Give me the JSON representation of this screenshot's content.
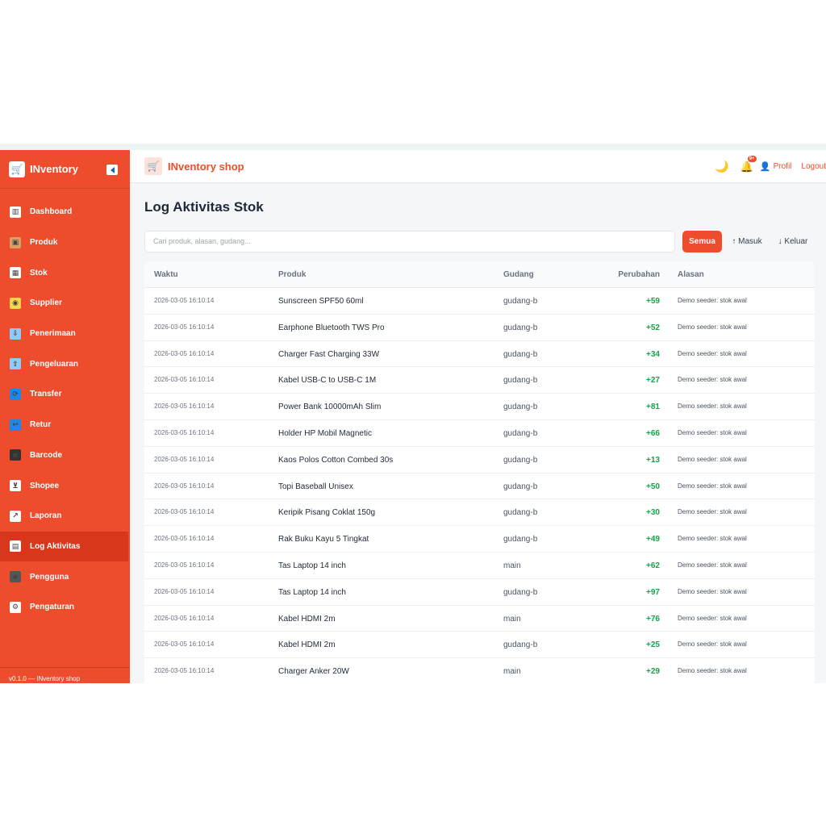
{
  "sidebar": {
    "brand": "INventory",
    "footer": "v0.1.0 — INventory shop",
    "items": [
      {
        "label": "Dashboard",
        "icon": "bar-chart-icon"
      },
      {
        "label": "Produk",
        "icon": "box-icon"
      },
      {
        "label": "Stok",
        "icon": "grid-icon"
      },
      {
        "label": "Supplier",
        "icon": "handshake-icon"
      },
      {
        "label": "Penerimaan",
        "icon": "inbox-tray-icon"
      },
      {
        "label": "Pengeluaran",
        "icon": "outbox-tray-icon"
      },
      {
        "label": "Transfer",
        "icon": "refresh-icon"
      },
      {
        "label": "Retur",
        "icon": "return-icon"
      },
      {
        "label": "Barcode",
        "icon": "camera-icon"
      },
      {
        "label": "Shopee",
        "icon": "cart-icon"
      },
      {
        "label": "Laporan",
        "icon": "chart-up-icon"
      },
      {
        "label": "Log Aktivitas",
        "icon": "clipboard-icon"
      },
      {
        "label": "Pengguna",
        "icon": "users-icon"
      },
      {
        "label": "Pengaturan",
        "icon": "gear-icon"
      }
    ]
  },
  "header": {
    "title": "INventory shop",
    "badge": "9+",
    "profil": "Profil",
    "logout": "Logout"
  },
  "page": {
    "title": "Log Aktivitas Stok",
    "search_placeholder": "Cari produk, alasan, gudang...",
    "filters": {
      "all": "Semua",
      "in": "↑ Masuk",
      "out": "↓ Keluar"
    }
  },
  "table": {
    "headers": {
      "time": "Waktu",
      "product": "Produk",
      "warehouse": "Gudang",
      "change": "Perubahan",
      "reason": "Alasan"
    },
    "rows": [
      {
        "time": "2026-03-05 16:10:14",
        "product": "Sunscreen SPF50 60ml",
        "warehouse": "gudang-b",
        "change": "+59",
        "reason": "Demo seeder: stok awal"
      },
      {
        "time": "2026-03-05 16:10:14",
        "product": "Earphone Bluetooth TWS Pro",
        "warehouse": "gudang-b",
        "change": "+52",
        "reason": "Demo seeder: stok awal"
      },
      {
        "time": "2026-03-05 16:10:14",
        "product": "Charger Fast Charging 33W",
        "warehouse": "gudang-b",
        "change": "+34",
        "reason": "Demo seeder: stok awal"
      },
      {
        "time": "2026-03-05 16:10:14",
        "product": "Kabel USB-C to USB-C 1M",
        "warehouse": "gudang-b",
        "change": "+27",
        "reason": "Demo seeder: stok awal"
      },
      {
        "time": "2026-03-05 16:10:14",
        "product": "Power Bank 10000mAh Slim",
        "warehouse": "gudang-b",
        "change": "+81",
        "reason": "Demo seeder: stok awal"
      },
      {
        "time": "2026-03-05 16:10:14",
        "product": "Holder HP Mobil Magnetic",
        "warehouse": "gudang-b",
        "change": "+66",
        "reason": "Demo seeder: stok awal"
      },
      {
        "time": "2026-03-05 16:10:14",
        "product": "Kaos Polos Cotton Combed 30s",
        "warehouse": "gudang-b",
        "change": "+13",
        "reason": "Demo seeder: stok awal"
      },
      {
        "time": "2026-03-05 16:10:14",
        "product": "Topi Baseball Unisex",
        "warehouse": "gudang-b",
        "change": "+50",
        "reason": "Demo seeder: stok awal"
      },
      {
        "time": "2026-03-05 16:10:14",
        "product": "Keripik Pisang Coklat 150g",
        "warehouse": "gudang-b",
        "change": "+30",
        "reason": "Demo seeder: stok awal"
      },
      {
        "time": "2026-03-05 16:10:14",
        "product": "Rak Buku Kayu 5 Tingkat",
        "warehouse": "gudang-b",
        "change": "+49",
        "reason": "Demo seeder: stok awal"
      },
      {
        "time": "2026-03-05 16:10:14",
        "product": "Tas Laptop 14 inch",
        "warehouse": "main",
        "change": "+62",
        "reason": "Demo seeder: stok awal"
      },
      {
        "time": "2026-03-05 16:10:14",
        "product": "Tas Laptop 14 inch",
        "warehouse": "gudang-b",
        "change": "+97",
        "reason": "Demo seeder: stok awal"
      },
      {
        "time": "2026-03-05 16:10:14",
        "product": "Kabel HDMI 2m",
        "warehouse": "main",
        "change": "+76",
        "reason": "Demo seeder: stok awal"
      },
      {
        "time": "2026-03-05 16:10:14",
        "product": "Kabel HDMI 2m",
        "warehouse": "gudang-b",
        "change": "+25",
        "reason": "Demo seeder: stok awal"
      },
      {
        "time": "2026-03-05 16:10:14",
        "product": "Charger Anker 20W",
        "warehouse": "main",
        "change": "+29",
        "reason": "Demo seeder: stok awal"
      }
    ]
  },
  "colors": {
    "brand": "#ee4d2d",
    "active": "#d7381b",
    "positive": "#16a34a"
  }
}
